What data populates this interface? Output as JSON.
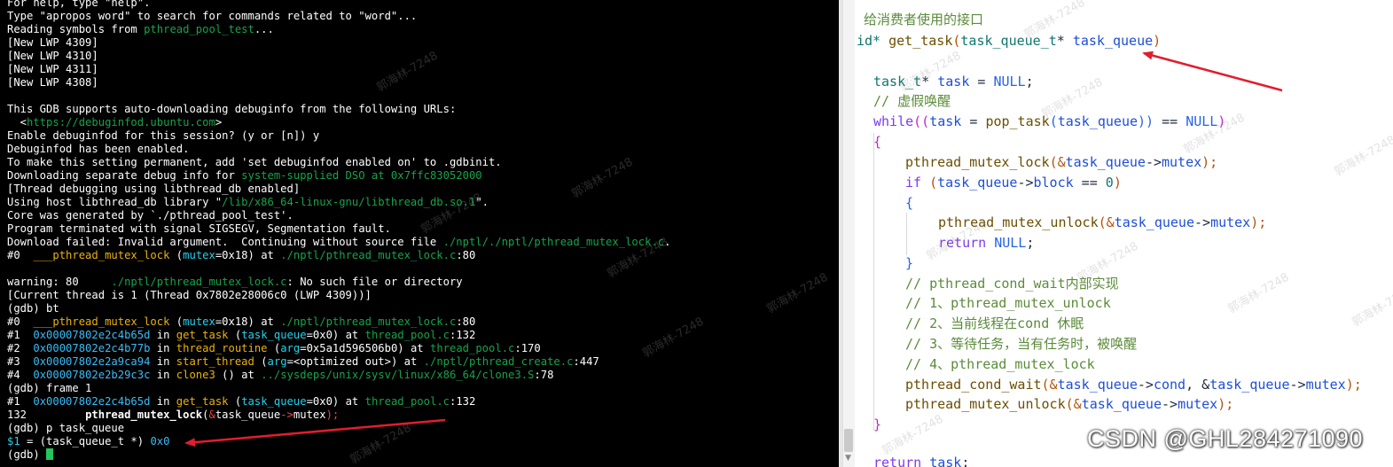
{
  "terminal": {
    "help": "For help, type \"help\".",
    "apropos": "Type \"apropos word\" to search for commands related to \"word\"...",
    "reading_prefix": "Reading symbols from ",
    "reading_target": "pthread_pool_test",
    "reading_suffix": "...",
    "lwp1": "[New LWP 4309]",
    "lwp2": "[New LWP 4310]",
    "lwp3": "[New LWP 4311]",
    "lwp4": "[New LWP 4308]",
    "debuginfod_support": "This GDB supports auto-downloading debuginfo from the following URLs:",
    "debuginfod_url_open": "  <",
    "debuginfod_url": "https://debuginfod.ubuntu.com",
    "debuginfod_url_close": ">",
    "enable_prompt": "Enable debuginfod for this session? (y or [n]) y",
    "enabled": "Debuginfod has been enabled.",
    "permanent": "To make this setting permanent, add 'set debuginfod enabled on' to .gdbinit.",
    "dso_prefix": "Downloading separate debug info for ",
    "dso_target": "system-supplied DSO at 0x7ffc83052000",
    "thread_debug": "[Thread debugging using libthread_db enabled]",
    "libthread_prefix": "Using host libthread_db library \"",
    "libthread_path": "/lib/x86_64-linux-gnu/libthread_db.so.1",
    "libthread_suffix": "\".",
    "core": "Core was generated by `./pthread_pool_test'.",
    "terminated": "Program terminated with signal SIGSEGV, Segmentation fault.",
    "download_failed_prefix": "Download failed: Invalid argument.  Continuing without source file ",
    "download_failed_path": "./nptl/./nptl/pthread_mutex_lock.c",
    "download_failed_suffix": ".",
    "frame0_num": "#0  ",
    "frame0_func": "___pthread_mutex_lock",
    "frame0_args_open": " (",
    "frame0_arg": "mutex",
    "frame0_args_val": "=0x18) at ",
    "frame0_file": "./nptl/pthread_mutex_lock.c",
    "frame0_line": ":80",
    "warning_prefix": "warning: 80     ",
    "warning_file": "./nptl/pthread_mutex_lock.c",
    "warning_suffix": ": No such file or directory",
    "current_thread": "[Current thread is 1 (Thread 0x7802e28006c0 (LWP 4309))]",
    "gdb_bt": "(gdb) bt",
    "bt0_num": "#0  ",
    "bt0_func": "___pthread_mutex_lock",
    "bt0_open": " (",
    "bt0_arg": "mutex",
    "bt0_val": "=0x18) at ",
    "bt0_file": "./nptl/pthread_mutex_lock.c",
    "bt0_line": ":80",
    "bt1_num": "#1  ",
    "bt1_addr": "0x00007802e2c4b65d",
    "bt1_in": " in ",
    "bt1_func": "get_task",
    "bt1_open": " (",
    "bt1_arg": "task_queue",
    "bt1_val": "=0x0) at ",
    "bt1_file": "thread_pool.c",
    "bt1_line": ":132",
    "bt2_num": "#2  ",
    "bt2_addr": "0x00007802e2c4b77b",
    "bt2_in": " in ",
    "bt2_func": "thread_routine",
    "bt2_open": " (",
    "bt2_arg": "arg",
    "bt2_val": "=0x5a1d596506b0) at ",
    "bt2_file": "thread_pool.c",
    "bt2_line": ":170",
    "bt3_num": "#3  ",
    "bt3_addr": "0x00007802e2a9ca94",
    "bt3_in": " in ",
    "bt3_func": "start_thread",
    "bt3_open": " (",
    "bt3_arg": "arg",
    "bt3_val": "=<optimized out>) at ",
    "bt3_file": "./nptl/pthread_create.c",
    "bt3_line": ":447",
    "bt4_num": "#4  ",
    "bt4_addr": "0x00007802e2b29c3c",
    "bt4_in": " in ",
    "bt4_func": "clone3",
    "bt4_val": " () at ",
    "bt4_file": "../sysdeps/unix/sysv/linux/x86_64/clone3.S",
    "bt4_line": ":78",
    "gdb_frame": "(gdb) frame 1",
    "fr1_num": "#1  ",
    "fr1_addr": "0x00007802e2c4b65d",
    "fr1_in": " in ",
    "fr1_func": "get_task",
    "fr1_open": " (",
    "fr1_arg": "task_queue",
    "fr1_val": "=0x0) at ",
    "fr1_file": "thread_pool.c",
    "fr1_line": ":132",
    "src_lineno": "132\t    ",
    "src_call": "pthread_mutex_lock",
    "src_open": "(",
    "src_amp": "&",
    "src_var": "task_queue",
    "src_arrow": "->",
    "src_field": "mutex",
    "src_close": ");",
    "gdb_print": "(gdb) p task_queue",
    "print_var": "$1",
    "print_eq": " = (task_queue_t *) ",
    "print_val": "0x0",
    "gdb_prompt": "(gdb) "
  },
  "editor": {
    "comment_top": "给消费者使用的接口",
    "sig_void": "id*",
    "sig_fn": "get_task",
    "sig_open": "(",
    "sig_type": "task_queue_t",
    "sig_star": "* ",
    "sig_param": "task_queue",
    "sig_close": ")",
    "l1_type": "task_t",
    "l1_star": "* ",
    "l1_var": "task",
    "l1_eq": " = ",
    "l1_null": "NULL",
    "l1_semi": ";",
    "l2_comment": "// 虚假唤醒",
    "l3_kw": "while",
    "l3_open": "((",
    "l3_var": "task",
    "l3_eq": " = ",
    "l3_fn": "pop_task",
    "l3_par": "(",
    "l3_arg": "task_queue",
    "l3_cl": "))",
    "l3_cmp": " == ",
    "l3_null": "NULL",
    "l3_end": ")",
    "l4_brace": "{",
    "l5_fn": "pthread_mutex_lock",
    "l5_open": "(&",
    "l5_var": "task_queue",
    "l5_arrow": "->",
    "l5_field": "mutex",
    "l5_close": ");",
    "l6_kw": "if",
    "l6_open": " (",
    "l6_var": "task_queue",
    "l6_arrow": "->",
    "l6_field": "block",
    "l6_cmp": " == ",
    "l6_num": "0",
    "l6_close": ")",
    "l7_brace": "{",
    "l8_fn": "pthread_mutex_unlock",
    "l8_open": "(&",
    "l8_var": "task_queue",
    "l8_arrow": "->",
    "l8_field": "mutex",
    "l8_close": ");",
    "l9_kw": "return",
    "l9_null": "NULL",
    "l9_semi": ";",
    "l10_brace": "}",
    "c1": "// pthread_cond_wait内部实现",
    "c2": "// 1、pthread_mutex_unlock",
    "c3": "// 2、当前线程在cond 休眠",
    "c4": "// 3、等待任务，当有任务时，被唤醒",
    "c5": "// 4、pthread_mutex_lock",
    "l11_fn": "pthread_cond_wait",
    "l11_open": "(&",
    "l11_var1": "task_queue",
    "l11_arrow1": "->",
    "l11_field1": "cond",
    "l11_mid": ", &",
    "l11_var2": "task_queue",
    "l11_arrow2": "->",
    "l11_field2": "mutex",
    "l11_close": ");",
    "l12_fn": "pthread_mutex_unlock",
    "l12_open": "(&",
    "l12_var": "task_queue",
    "l12_arrow": "->",
    "l12_field": "mutex",
    "l12_close": ");",
    "l13_brace": "}",
    "l14_kw": "return",
    "l14_var": "task",
    "l14_semi": ";"
  },
  "watermark_text": "郭海林-7248",
  "brand": "CSDN @GHL284271090",
  "colors": {
    "terminal_bg": "#000000",
    "path_green": "#16a34a",
    "arrow_red": "#e11d2e",
    "cursor_green": "#22c55e"
  }
}
